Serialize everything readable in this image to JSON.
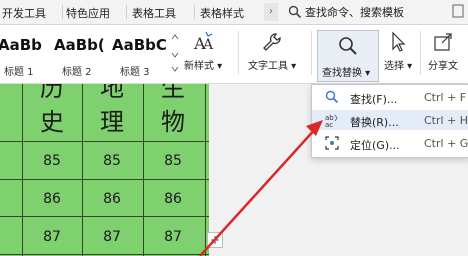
{
  "tabs": {
    "items": [
      "开发工具",
      "特色应用",
      "表格工具",
      "表格样式"
    ],
    "more": "›",
    "search_text": "查找命令、搜索模板"
  },
  "ribbon": {
    "styles": [
      {
        "sample": "AaBb",
        "label": "标题 1"
      },
      {
        "sample": "AaBb(",
        "label": "标题 2"
      },
      {
        "sample": "AaBbC",
        "label": "标题 3"
      }
    ],
    "new_style": "新样式",
    "text_tools": "文字工具",
    "find_replace": "查找替换",
    "select": "选择",
    "share": "分享文"
  },
  "find_menu": {
    "items": [
      {
        "label": "查找(F)...",
        "shortcut": "Ctrl + F"
      },
      {
        "label": "替换(R)...",
        "shortcut": "Ctrl + H"
      },
      {
        "label": "定位(G)...",
        "shortcut": "Ctrl + G"
      }
    ]
  },
  "table": {
    "headers": [
      "历史",
      "地理",
      "生物"
    ],
    "headers_top": [
      "历",
      "地",
      "生"
    ],
    "headers_bottom": [
      "史",
      "理",
      "物"
    ],
    "rows": [
      [
        "85",
        "85",
        "85"
      ],
      [
        "86",
        "86",
        "86"
      ],
      [
        "87",
        "87",
        "87"
      ]
    ]
  },
  "add_column": "+",
  "colors": {
    "cell_fill": "#7fd06f",
    "annotation_arrow": "#d8282a",
    "menu_highlight": "#e4ecf7"
  }
}
